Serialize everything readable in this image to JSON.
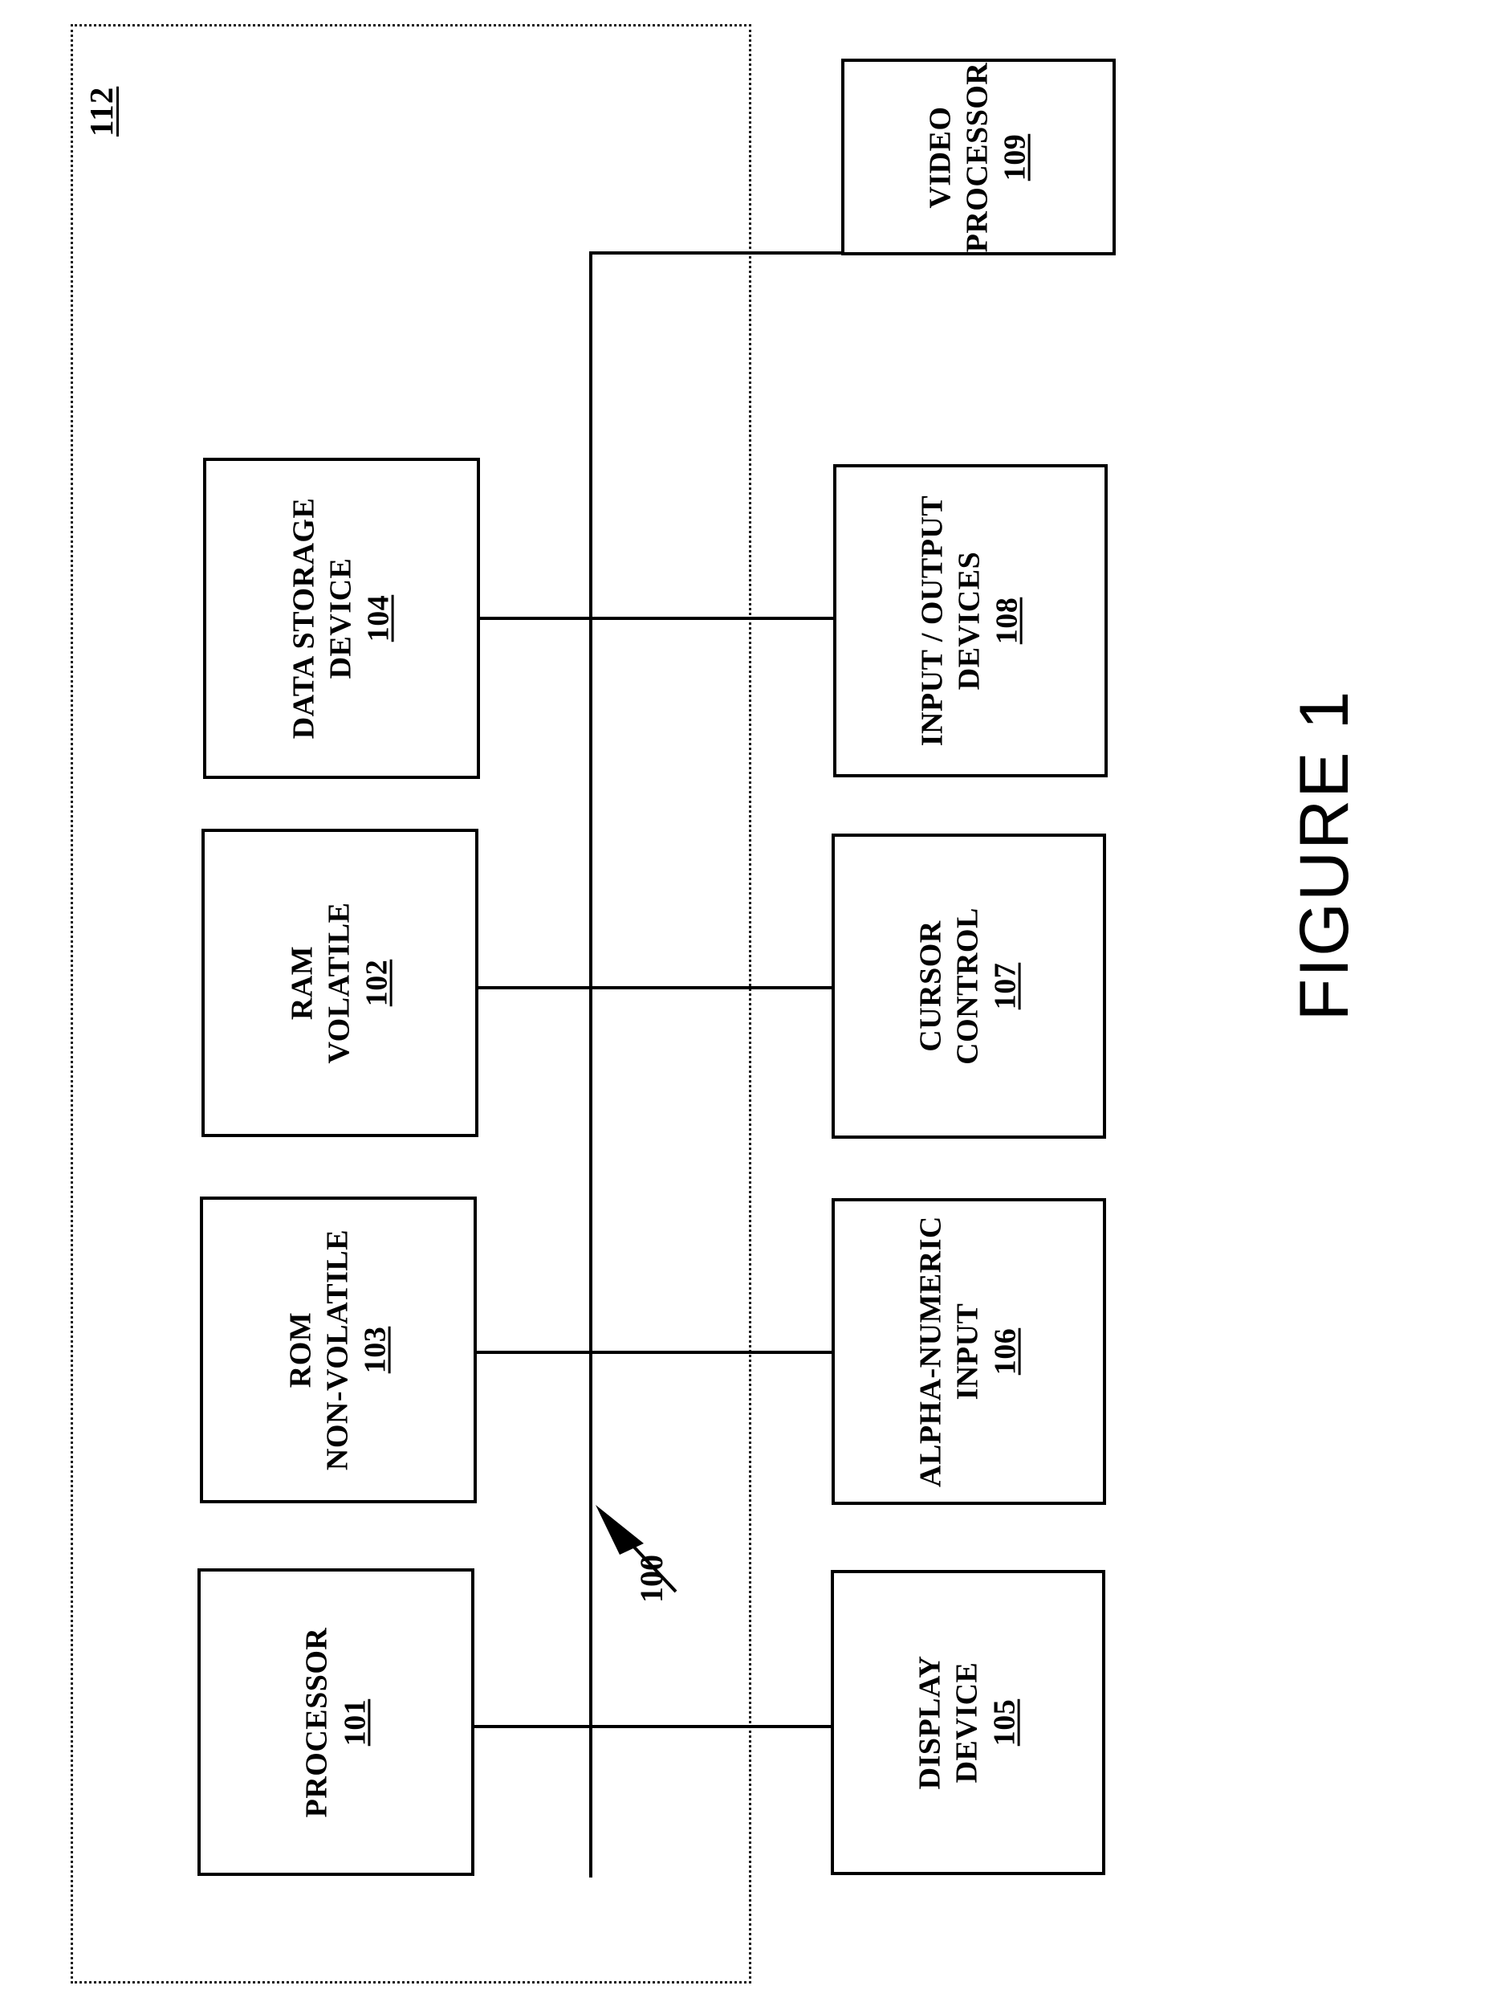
{
  "figure": {
    "caption": "FIGURE 1",
    "system_ref": "112",
    "bus_ref": "100"
  },
  "boxes": [
    {
      "id": "processor",
      "lines": [
        "PROCESSOR"
      ],
      "number": "101"
    },
    {
      "id": "rom-non-volatile",
      "lines": [
        "ROM",
        "NON-VOLATILE"
      ],
      "number": "103"
    },
    {
      "id": "ram-volatile",
      "lines": [
        "RAM",
        "VOLATILE"
      ],
      "number": "102"
    },
    {
      "id": "data-storage-device",
      "lines": [
        "DATA STORAGE",
        "DEVICE"
      ],
      "number": "104"
    },
    {
      "id": "display-device",
      "lines": [
        "DISPLAY",
        "DEVICE"
      ],
      "number": "105"
    },
    {
      "id": "alpha-numeric-input",
      "lines": [
        "ALPHA-NUMERIC",
        "INPUT"
      ],
      "number": "106"
    },
    {
      "id": "cursor-control",
      "lines": [
        "CURSOR",
        "CONTROL"
      ],
      "number": "107"
    },
    {
      "id": "input-output-devices",
      "lines": [
        "INPUT / OUTPUT",
        "DEVICES"
      ],
      "number": "108"
    },
    {
      "id": "video-processor",
      "lines": [
        "VIDEO",
        "PROCESSOR"
      ],
      "number": "109"
    }
  ],
  "colors": {
    "stroke": "#000000",
    "background": "#ffffff"
  }
}
